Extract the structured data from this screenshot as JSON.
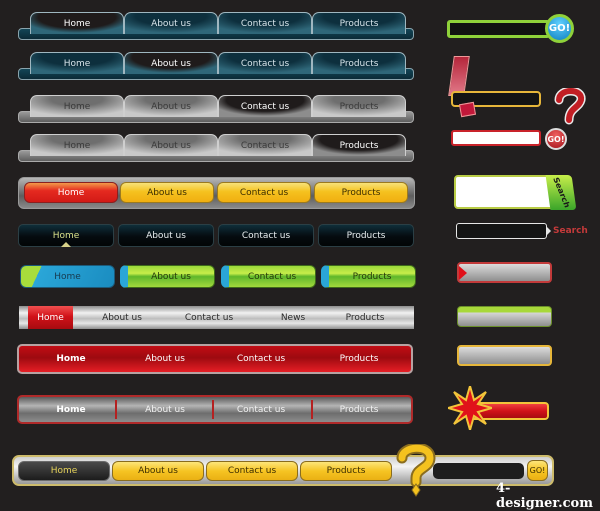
{
  "menus": {
    "teal1": {
      "items": [
        "Home",
        "About us",
        "Contact us",
        "Products"
      ],
      "active": "Home"
    },
    "teal2": {
      "items": [
        "Home",
        "About us",
        "Contact us",
        "Products"
      ],
      "active": "About us"
    },
    "gray1": {
      "items": [
        "Home",
        "About us",
        "Contact us",
        "Products"
      ],
      "active": "Contact us"
    },
    "gray2": {
      "items": [
        "Home",
        "About us",
        "Contact us",
        "Products"
      ],
      "active": "Products"
    },
    "yellow": {
      "items": [
        "Home",
        "About us",
        "Contact us",
        "Products"
      ],
      "active": "Home"
    },
    "dark": {
      "items": [
        "Home",
        "About us",
        "Contact us",
        "Products"
      ],
      "active": "Home"
    },
    "green": {
      "items": [
        "Home",
        "About us",
        "Contact us",
        "Products"
      ],
      "active": "Home"
    },
    "silver": {
      "items": [
        "Home",
        "About us",
        "Contact us",
        "News",
        "Products"
      ],
      "active": "Home"
    },
    "red": {
      "items": [
        "Home",
        "About us",
        "Contact us",
        "Products"
      ],
      "active": "Home"
    },
    "graybar": {
      "items": [
        "Home",
        "About us",
        "Contact us",
        "Products"
      ],
      "active": "Home"
    },
    "bottom": {
      "items": [
        "Home",
        "About us",
        "Contact us",
        "Products"
      ],
      "active": "Home"
    }
  },
  "search_widgets": {
    "green_go": {
      "button": "GO!",
      "value": ""
    },
    "alert_box": {
      "value": ""
    },
    "red_go": {
      "button": "GO!",
      "value": ""
    },
    "green_search": {
      "button": "Search",
      "value": ""
    },
    "outline_search": {
      "button": "Search",
      "value": ""
    },
    "bottom_go": {
      "button": "GO!",
      "value": ""
    }
  },
  "watermark": "4-designer.com",
  "colors": {
    "background": "#221f1f",
    "accent_yellow": "#f5c21f",
    "accent_red": "#d11219",
    "accent_teal": "#134556",
    "accent_green": "#8fd13a"
  }
}
